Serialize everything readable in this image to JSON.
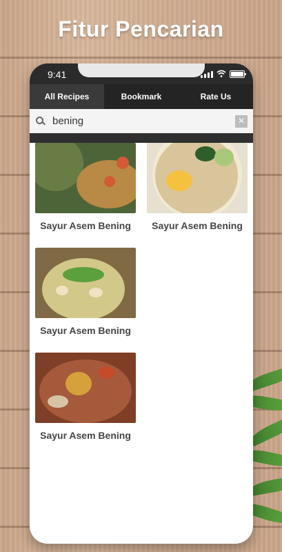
{
  "headline": "Fitur Pencarian",
  "status": {
    "time": "9:41"
  },
  "tabs": [
    "All Recipes",
    "Bookmark",
    "Rate Us"
  ],
  "search": {
    "value": "bening",
    "clear": "×"
  },
  "results": [
    {
      "title": "Sayur Asem Bening",
      "thumb": "soup-photo-1",
      "colors": [
        "#4d6438",
        "#b88a45",
        "#d45a36"
      ]
    },
    {
      "title": "Sayur Asem Bening",
      "thumb": "soup-photo-2",
      "colors": [
        "#e7dfcf",
        "#c6a04e",
        "#2f5e2a"
      ]
    },
    {
      "title": "Sayur Asem Bening",
      "thumb": "soup-photo-3",
      "colors": [
        "#d2c889",
        "#7f6a44",
        "#5ba03c"
      ]
    },
    {
      "title": "Sayur Asem Bening",
      "thumb": "soup-photo-4",
      "colors": [
        "#7e3f26",
        "#d6a13a",
        "#a55a3b"
      ]
    }
  ]
}
